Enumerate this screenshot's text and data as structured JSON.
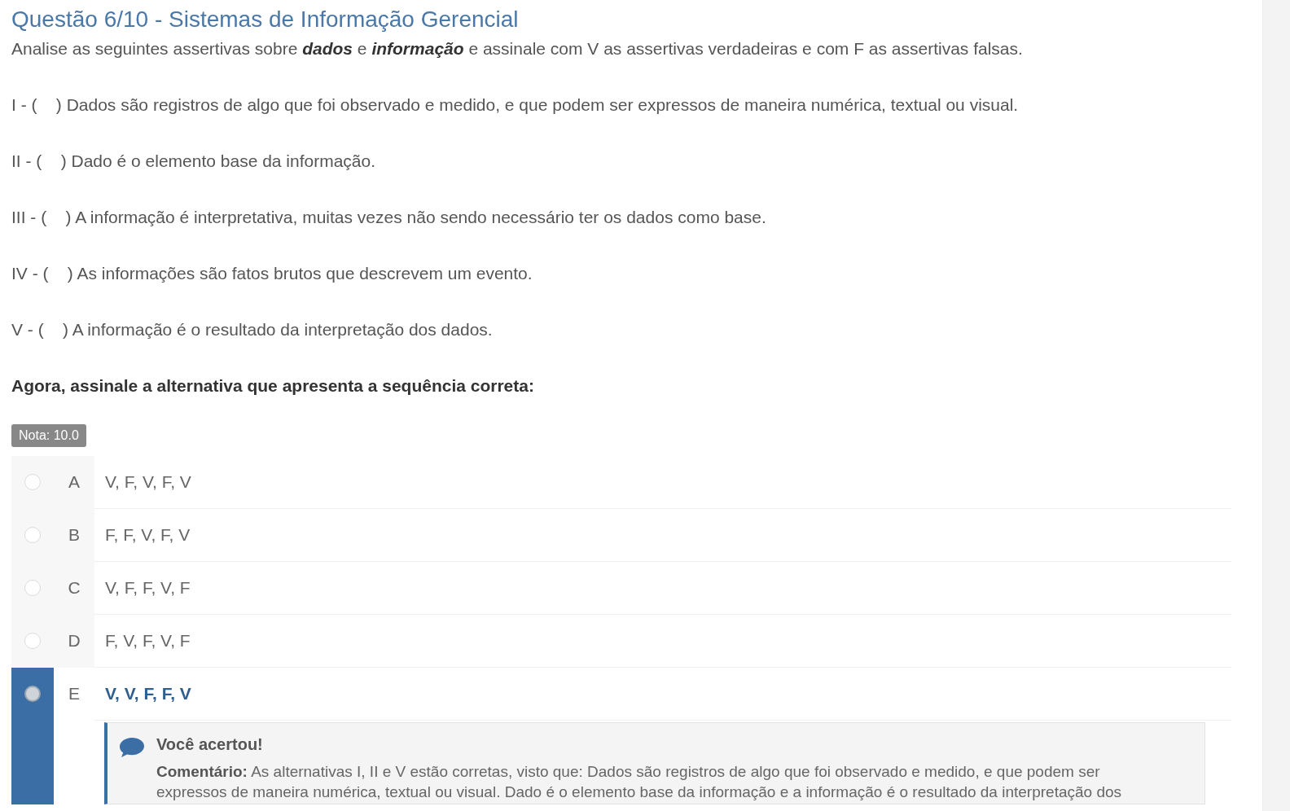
{
  "question": {
    "title": "Questão 6/10 - Sistemas de Informação Gerencial",
    "intro": "Analise as seguintes assertivas sobre **dados** e **informação** e assinale com V as assertivas verdadeiras e com F as assertivas falsas.",
    "statements": [
      "I - (    ) Dados são registros de algo que foi observado e medido, e que podem ser expressos de maneira numérica, textual ou visual.",
      "II - (    ) Dado é o elemento base da informação.",
      "III - (    ) A informação é interpretativa, muitas vezes não sendo necessário ter os dados como base.",
      "IV - (    ) As informações são fatos brutos que descrevem um evento.",
      "V - (    ) A informação é o resultado da interpretação dos dados."
    ],
    "prompt": "Agora, assinale a alternativa que apresenta a sequência correta:"
  },
  "grade_badge": "Nota: 10.0",
  "options": [
    {
      "letter": "A",
      "text": "V, F, V, F, V",
      "selected": false
    },
    {
      "letter": "B",
      "text": "F, F, V, F, V",
      "selected": false
    },
    {
      "letter": "C",
      "text": "V, F, F, V, F",
      "selected": false
    },
    {
      "letter": "D",
      "text": "F, V, F, V, F",
      "selected": false
    },
    {
      "letter": "E",
      "text": "V, V, F, F, V",
      "selected": true
    }
  ],
  "feedback": {
    "title": "Você acertou!",
    "comment": "**Comentário:** As alternativas I, II e V estão corretas, visto que: Dados são registros de algo que foi observado e medido, e que podem ser expressos de maneira numérica, textual ou visual. Dado é o elemento base da informação e a informação é o resultado da interpretação dos"
  }
}
